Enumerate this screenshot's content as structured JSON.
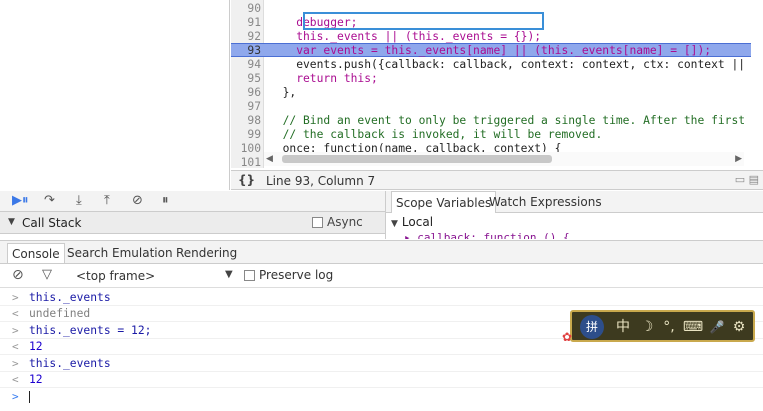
{
  "editor": {
    "lines": [
      {
        "num": "90",
        "code": "  "
      },
      {
        "num": "91",
        "code": "    debugger;"
      },
      {
        "num": "92",
        "code": "    this._events || (this._events = {});"
      },
      {
        "num": "93",
        "code": "    var events = this._events[name] || (this._events[name] = []);"
      },
      {
        "num": "94",
        "code": "    events.push({callback: callback, context: context, ctx: context ||"
      },
      {
        "num": "95",
        "code": "    return this;"
      },
      {
        "num": "96",
        "code": "  },"
      },
      {
        "num": "97",
        "code": ""
      },
      {
        "num": "98",
        "code": "  // Bind an event to only be triggered a single time. After the first"
      },
      {
        "num": "99",
        "code": "  // the callback is invoked, it will be removed."
      },
      {
        "num": "100",
        "code": "  once: function(name, callback, context) {"
      },
      {
        "num": "101",
        "code": ""
      }
    ],
    "highlighted_line": "93"
  },
  "status": {
    "braces": "{}",
    "position": "Line 93, Column 7"
  },
  "callstack": {
    "title": "Call Stack",
    "async_label": "Async"
  },
  "scope": {
    "tabs": [
      "Scope Variables",
      "Watch Expressions"
    ],
    "local_label": "Local",
    "callback_row": "▸ callback: function () {"
  },
  "drawer": {
    "tabs": [
      "Console",
      "Search",
      "Emulation",
      "Rendering"
    ]
  },
  "console_toolbar": {
    "frame": "<top frame>",
    "preserve_log": "Preserve log"
  },
  "console": {
    "rows": [
      {
        "prefix": ">",
        "text": "this._events",
        "kind": "input"
      },
      {
        "prefix": "<",
        "text": "undefined",
        "kind": "undef"
      },
      {
        "prefix": ">",
        "text": "this._events = 12;",
        "kind": "input"
      },
      {
        "prefix": "<",
        "text": "12",
        "kind": "num"
      },
      {
        "prefix": ">",
        "text": "this._events",
        "kind": "input"
      },
      {
        "prefix": "<",
        "text": "12",
        "kind": "num"
      }
    ],
    "prompt": ">"
  },
  "ime": {
    "logo": "拼",
    "mode": "中",
    "items": [
      "☽",
      "°,",
      "⌨",
      "🎤",
      "⚙"
    ]
  },
  "colors": {
    "highlight": "#8fa8ec",
    "debugger_box": "#3a8fd8",
    "ime_bg": "#3d3a1f"
  }
}
